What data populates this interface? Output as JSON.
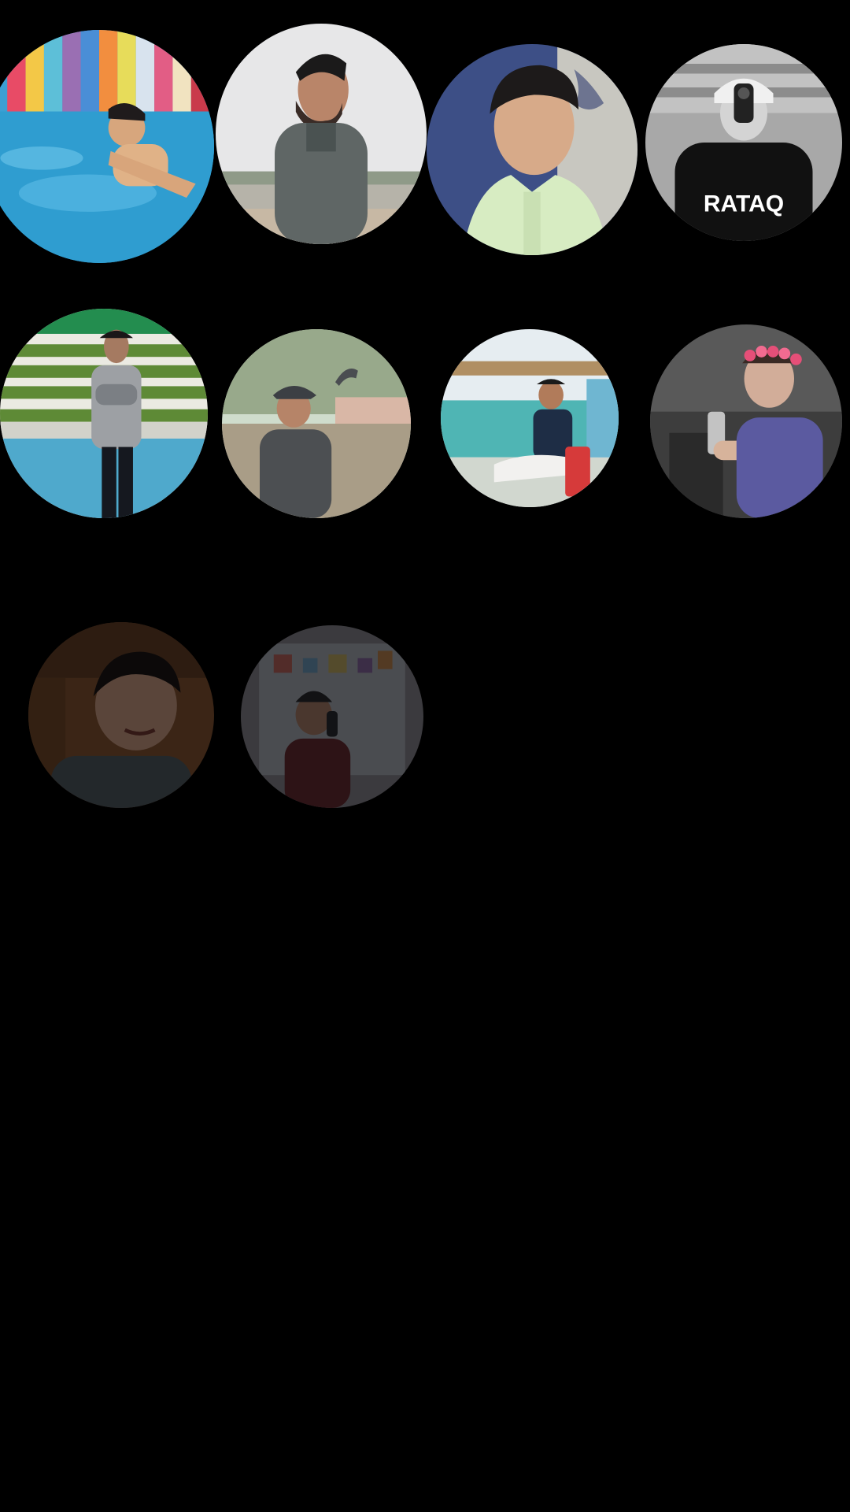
{
  "screen": {
    "background": "#000000"
  },
  "gallery": {
    "items": [
      {
        "id": "photo-1",
        "theme": "pool-colorful-wall",
        "dimmed": false
      },
      {
        "id": "photo-2",
        "theme": "man-gray-shirt-outdoor",
        "dimmed": false
      },
      {
        "id": "photo-3",
        "theme": "boy-light-green-shirt",
        "dimmed": false
      },
      {
        "id": "photo-4",
        "theme": "mirror-selfie-monochrome",
        "dimmed": false
      },
      {
        "id": "photo-5",
        "theme": "man-by-pool-gray-jersey",
        "dimmed": false
      },
      {
        "id": "photo-6",
        "theme": "boy-cap-outdoor",
        "dimmed": false
      },
      {
        "id": "photo-7",
        "theme": "sitting-chair-blue-wall",
        "dimmed": false
      },
      {
        "id": "photo-8",
        "theme": "mirror-selfie-flower-crown",
        "dimmed": false
      },
      {
        "id": "photo-9",
        "theme": "smiling-boy-dark",
        "dimmed": true
      },
      {
        "id": "photo-10",
        "theme": "mirror-selfie-room-dark",
        "dimmed": true
      }
    ]
  }
}
